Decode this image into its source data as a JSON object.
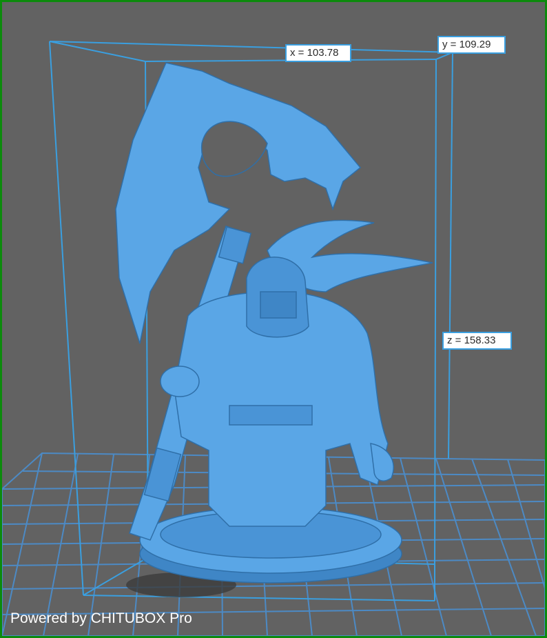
{
  "app": {
    "name": "CHITUBOX Pro",
    "watermark": "Powered by CHITUBOX Pro"
  },
  "dimensions": {
    "x_label": "x = 103.78",
    "y_label": "y = 109.29",
    "z_label": "z = 158.33"
  },
  "colors": {
    "background": "#626262",
    "frame": "#0c8a0c",
    "model": "#5aa6e6",
    "bounding_box": "#3a9fe0",
    "build_plate_grid": "#4a8fd0"
  },
  "icons": {
    "model": "dwarf-warrior-miniature-icon"
  }
}
